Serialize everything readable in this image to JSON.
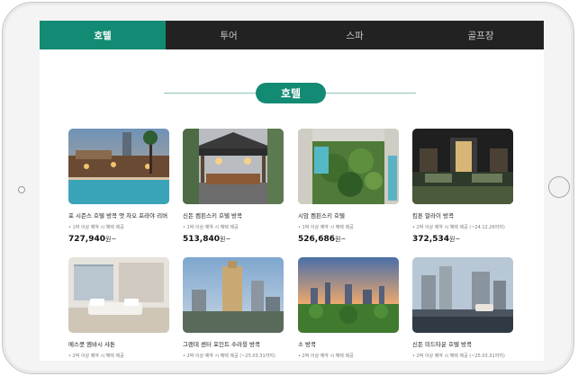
{
  "nav": {
    "tabs": [
      {
        "label": "호텔",
        "active": true
      },
      {
        "label": "투어",
        "active": false
      },
      {
        "label": "스파",
        "active": false
      },
      {
        "label": "골프장",
        "active": false
      }
    ]
  },
  "section": {
    "title": "호텔"
  },
  "colors": {
    "accent": "#138a73",
    "nav_bg": "#222222"
  },
  "hotels": [
    {
      "name": "포 시즌스 호텔 방콕 앳 차오 프라야 리버",
      "note": "• 1박 이상 예약 시 혜택 제공",
      "price": "727,940",
      "unit": "원~"
    },
    {
      "name": "신돈 켐핀스키 호텔 방콕",
      "note": "• 1박 이상 예약 시 혜택 제공",
      "price": "513,840",
      "unit": "원~"
    },
    {
      "name": "시암 켐핀스키 호텔",
      "note": "• 1박 이상 예약 시 혜택 제공",
      "price": "526,686",
      "unit": "원~"
    },
    {
      "name": "킴톤 말라이 방콕",
      "note": "• 2박 이상 예약 시 혜택 제공 (~24.12.26까지)",
      "price": "372,534",
      "unit": "원~"
    },
    {
      "name": "메스쿳 엠바시 샤톤",
      "note": "• 2박 이상 예약 시 혜택 제공",
      "price": "",
      "unit": ""
    },
    {
      "name": "그랜데 센터 포인트 수라윙 방콕",
      "note": "• 2박 이상 예약 시 혜택 제공 (~25.03.31까지)",
      "price": "",
      "unit": ""
    },
    {
      "name": "소 방콕",
      "note": "• 2박 이상 예약 시 혜택 제공",
      "price": "",
      "unit": ""
    },
    {
      "name": "신돈 미드타운 호텔 방콕",
      "note": "• 2박 이상 예약 시 혜택 제공 (~25.03.31까지)",
      "price": "",
      "unit": ""
    }
  ]
}
